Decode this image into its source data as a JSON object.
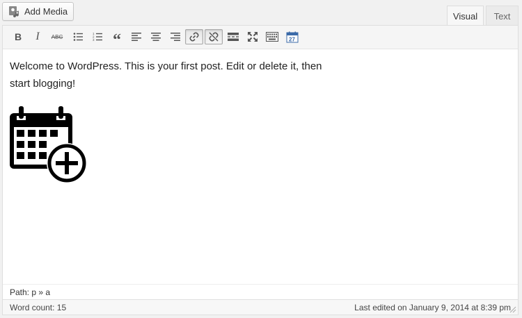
{
  "media": {
    "add_media_label": "Add Media"
  },
  "tabs": [
    {
      "label": "Visual",
      "selected": true
    },
    {
      "label": "Text",
      "selected": false
    }
  ],
  "toolbar": {
    "bold_label": "B",
    "italic_label": "I",
    "strike_label": "ABC",
    "quote_label": "“"
  },
  "content": {
    "paragraph": "Welcome to WordPress. This is your first post. Edit or delete it, then start blogging!"
  },
  "path": {
    "text": "Path: p » a"
  },
  "status": {
    "word_count": "Word count: 15",
    "last_edited": "Last edited on January 9, 2014 at 8:39 pm"
  },
  "icons": {
    "media": "camera-music-icon",
    "link": "link-icon",
    "unlink": "unlink-icon",
    "fullscreen": "fullscreen-icon",
    "calendar": "calendar-add-icon"
  }
}
